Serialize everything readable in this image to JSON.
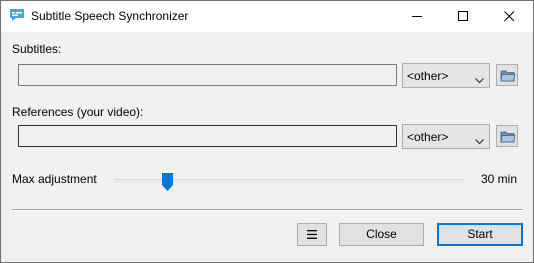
{
  "window": {
    "title": "Subtitle Speech Synchronizer",
    "icon": "speech-bubble-icon"
  },
  "subtitles": {
    "label": "Subtitles:",
    "path_value": "",
    "format_selected": "<other>",
    "browse_icon": "folder-open-icon"
  },
  "references": {
    "label": "References (your video):",
    "path_value": "",
    "format_selected": "<other>",
    "browse_icon": "folder-open-icon"
  },
  "max_adjustment": {
    "label": "Max adjustment",
    "value_text": "30 min",
    "slider_fraction": 0.15
  },
  "footer": {
    "menu_icon": "hamburger-menu-icon",
    "close_label": "Close",
    "start_label": "Start"
  },
  "colors": {
    "accent": "#0078d7",
    "window_bg": "#f0f0f0"
  }
}
